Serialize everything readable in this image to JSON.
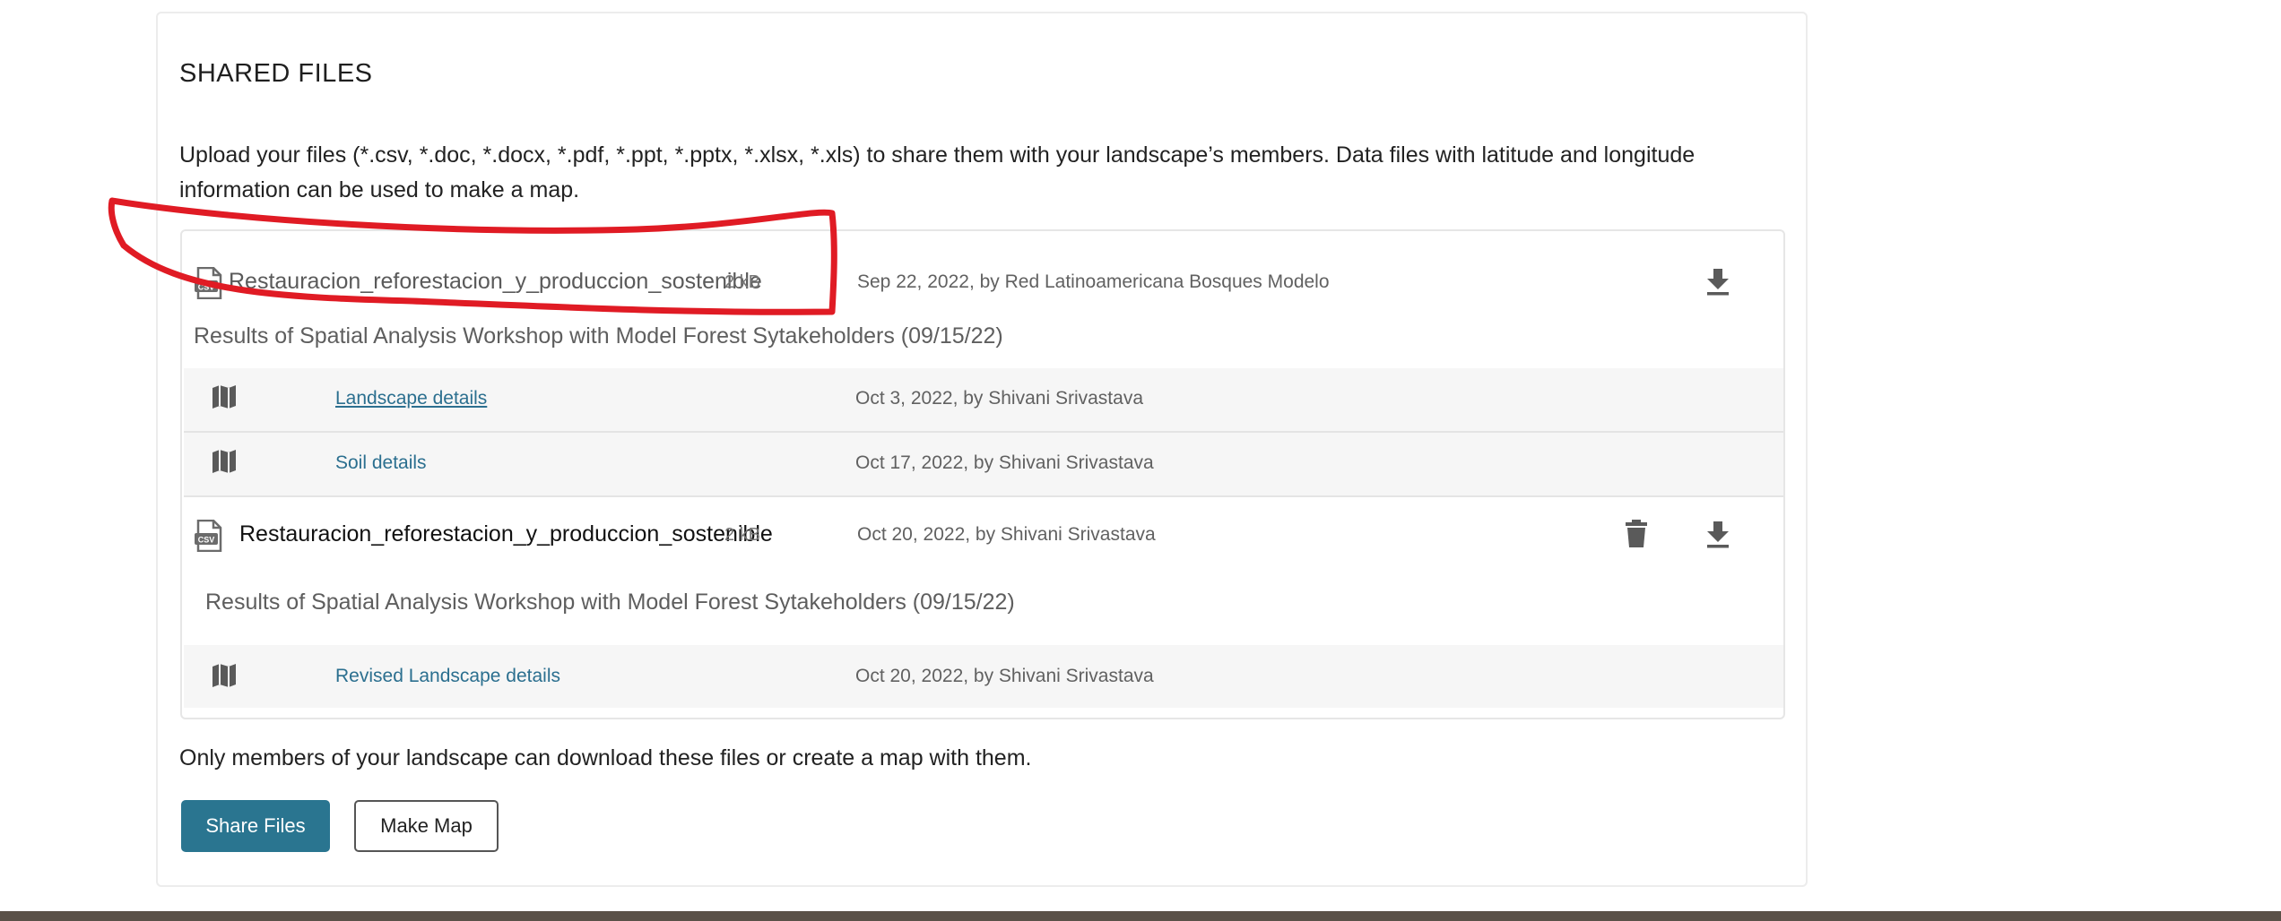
{
  "section": {
    "title": "SHARED FILES",
    "description": "Upload your files (*.csv, *.doc, *.docx, *.pdf, *.ppt, *.pptx, *.xlsx, *.xls) to share them with your landscape’s members. Data files with latitude and longitude information can be used to make a map."
  },
  "files": [
    {
      "icon": "csv-file-icon",
      "name": "Restauracion_reforestacion_y_produccion_sostenible",
      "size": "2 kB",
      "date": "Sep 22, 2022, by Red Latinoamericana Bosques Modelo",
      "description": "Results of Spatial Analysis Workshop with Model Forest Sytakeholders (09/15/22)",
      "maps": [
        {
          "icon": "map-icon",
          "label": "Landscape details",
          "date": "Oct 3, 2022, by Shivani Srivastava"
        },
        {
          "icon": "map-icon",
          "label": "Soil details",
          "date": "Oct 17, 2022, by Shivani Srivastava"
        }
      ]
    },
    {
      "icon": "csv-file-icon",
      "name": "Restauracion_reforestacion_y_produccion_sostenible",
      "size": "2 kB",
      "date": "Oct 20, 2022, by Shivani Srivastava",
      "description": "Results of Spatial Analysis Workshop with Model Forest Sytakeholders (09/15/22)",
      "maps": [
        {
          "icon": "map-icon",
          "label": "Revised Landscape details",
          "date": "Oct 20, 2022, by Shivani Srivastava"
        }
      ]
    }
  ],
  "footer": {
    "note": "Only members of your landscape can download these files or create a map with them.",
    "share_button": "Share Files",
    "map_button": "Make Map"
  },
  "colors": {
    "primary": "#2a7590",
    "link": "#2b6f8f",
    "annotation": "#e01b24"
  }
}
